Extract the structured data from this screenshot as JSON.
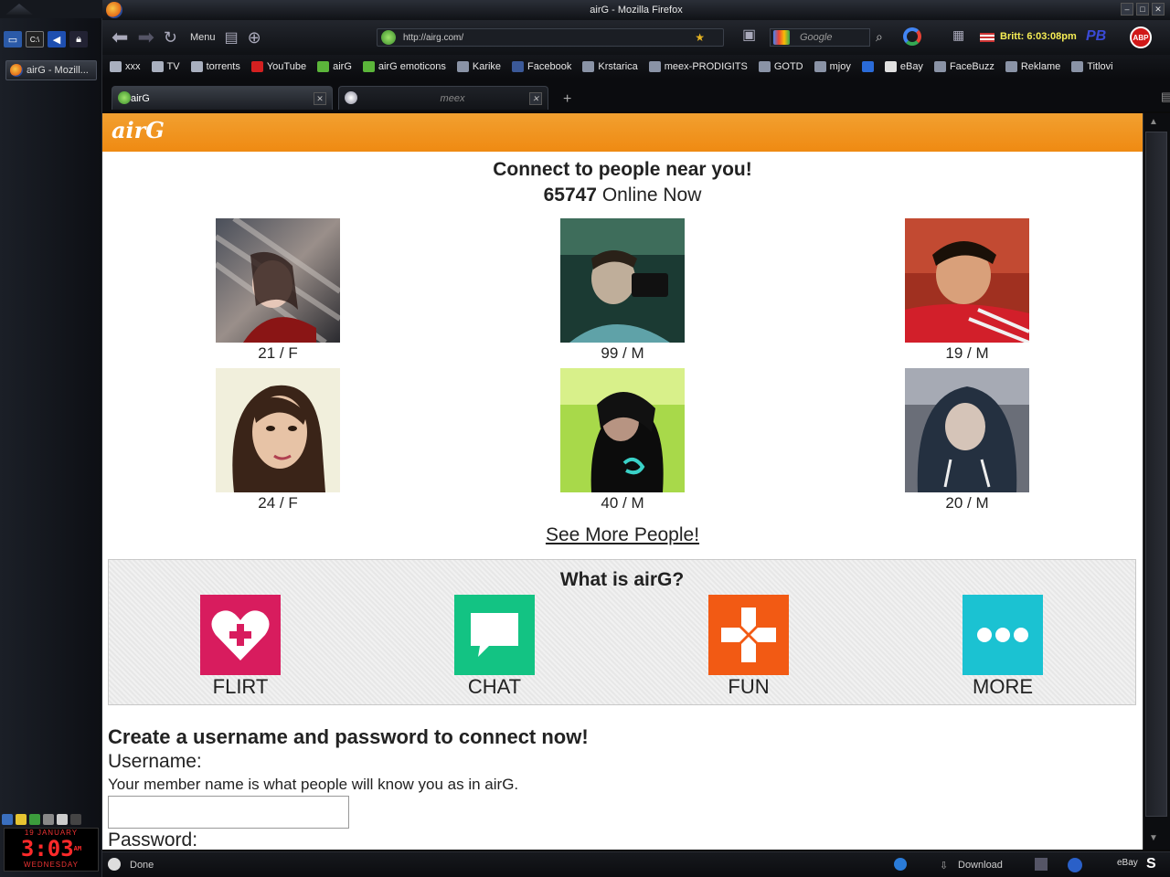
{
  "window": {
    "title": "airG - Mozilla Firefox",
    "minimize": "–",
    "maximize": "□",
    "close": "✕"
  },
  "taskbar": {
    "task_label": "airG - Mozill...",
    "clock": {
      "date": "19 JANUARY",
      "time": "3:03",
      "ampm": "AM",
      "day": "WEDNESDAY"
    }
  },
  "navbar": {
    "menu_label": "Menu",
    "url": "http://airg.com/",
    "search_placeholder": "Google",
    "status_text": "Britt: 6:03:08pm",
    "pb_label": "PB",
    "abp_label": "ABP"
  },
  "bookmarks": [
    {
      "label": "xxx",
      "icon": "folder-icon"
    },
    {
      "label": "TV",
      "icon": "folder-icon"
    },
    {
      "label": "torrents",
      "icon": "folder-icon"
    },
    {
      "label": "YouTube",
      "icon": "youtube-icon"
    },
    {
      "label": "airG",
      "icon": "airg-icon"
    },
    {
      "label": "airG emoticons",
      "icon": "airg-icon"
    },
    {
      "label": "Karike",
      "icon": "page-icon"
    },
    {
      "label": "Facebook",
      "icon": "facebook-icon"
    },
    {
      "label": "Krstarica",
      "icon": "page-icon"
    },
    {
      "label": "meex-PRODIGITS",
      "icon": "page-icon"
    },
    {
      "label": "GOTD",
      "icon": "page-icon"
    },
    {
      "label": "mjoy",
      "icon": "page-icon"
    },
    {
      "label": "",
      "icon": "arrow-up-icon"
    },
    {
      "label": "eBay",
      "icon": "ebay-icon"
    },
    {
      "label": "FaceBuzz",
      "icon": "page-icon"
    },
    {
      "label": "Reklame",
      "icon": "page-icon"
    },
    {
      "label": "Titlovi",
      "icon": "page-icon"
    }
  ],
  "tabs": [
    {
      "label": "airG",
      "active": true
    },
    {
      "label": "meex",
      "active": false
    }
  ],
  "page": {
    "logo": "airG",
    "headline": "Connect to people near you!",
    "online_count": "65747",
    "online_suffix": "Online Now",
    "people": [
      {
        "label": "21 / F"
      },
      {
        "label": "99 / M"
      },
      {
        "label": "19 / M"
      },
      {
        "label": "24 / F"
      },
      {
        "label": "40 / M"
      },
      {
        "label": "20 / M"
      }
    ],
    "see_more": "See More People!",
    "what_title": "What is airG?",
    "features": [
      {
        "label": "FLIRT",
        "color": "#d81c5e",
        "icon": "heart-plus-icon"
      },
      {
        "label": "CHAT",
        "color": "#13c383",
        "icon": "chat-bubble-icon"
      },
      {
        "label": "FUN",
        "color": "#f25a14",
        "icon": "gamepad-icon"
      },
      {
        "label": "MORE",
        "color": "#1bc2d2",
        "icon": "more-dots-icon"
      }
    ],
    "form_title": "Create a username and password to connect now!",
    "username_label": "Username:",
    "username_help": "Your member name is what people will know you as in airG.",
    "username_value": "",
    "password_label": "Password:"
  },
  "statusbar": {
    "status": "Done",
    "download": "Download",
    "s_label": "S"
  },
  "colors": {
    "header_orange": "#ef8a12",
    "clock_red": "#ff2a2a",
    "status_yellow": "#f7ee55"
  }
}
